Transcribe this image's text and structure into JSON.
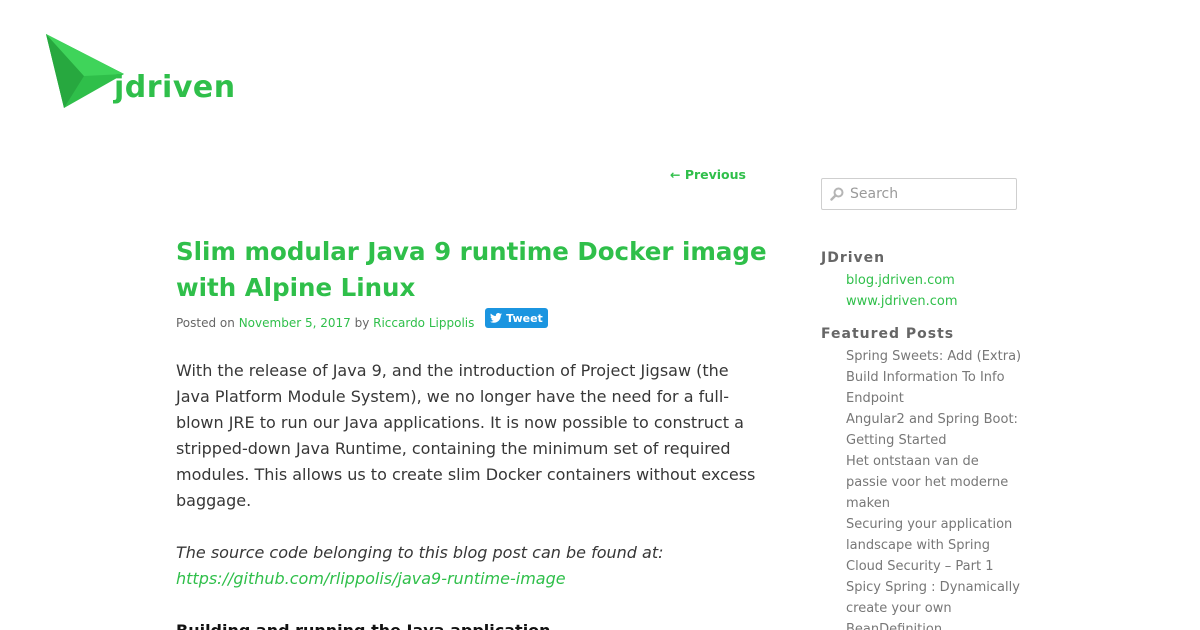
{
  "brand": {
    "name": "jdriven",
    "accent": "#2fbf4a"
  },
  "nav": {
    "previous": "← Previous"
  },
  "post": {
    "title": "Slim modular Java 9 runtime Docker image with Alpine Linux",
    "meta": {
      "posted_on": "Posted on",
      "date": "November 5, 2017",
      "by": "by",
      "author": "Riccardo Lippolis"
    },
    "tweet_label": "Tweet",
    "paragraphs": [
      "With the release of Java 9, and the introduction of Project Jigsaw (the Java Platform Module System), we no longer have the need for a full-blown JRE to run our Java applications. It is now possible to construct a stripped-down Java Runtime, containing the minimum set of required modules. This allows us to create slim Docker containers without excess baggage."
    ],
    "source_intro": "The source code belonging to this blog post can be found at:",
    "source_link": "https://github.com/rlippolis/java9-runtime-image",
    "heading": "Building and running the Java application"
  },
  "sidebar": {
    "search_placeholder": "Search",
    "jdriven_title": "JDriven",
    "jdriven_links": [
      "blog.jdriven.com",
      "www.jdriven.com"
    ],
    "featured_title": "Featured Posts",
    "featured_lines": [
      "Spring Sweets: Add (Extra)",
      "Build Information To Info",
      "Endpoint",
      "Angular2 and Spring Boot:",
      "Getting Started",
      "Het ontstaan van de",
      "passie voor het moderne",
      "maken",
      "Securing your application",
      "landscape with Spring",
      "Cloud Security – Part 1",
      "Spicy Spring : Dynamically",
      "create your own",
      "BeanDefinition"
    ]
  }
}
